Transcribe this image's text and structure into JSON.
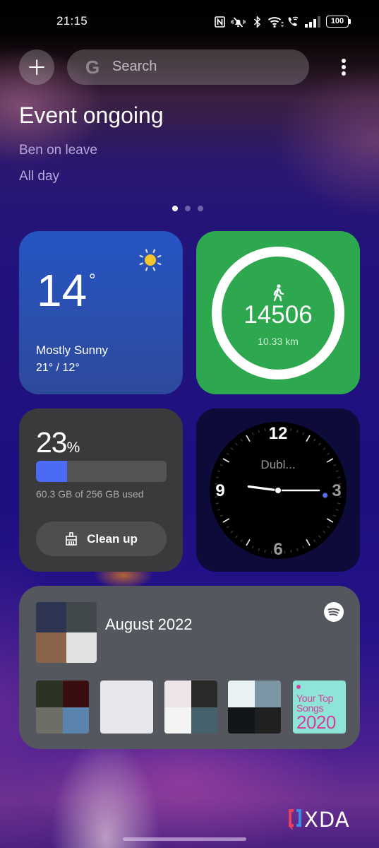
{
  "status_bar": {
    "time": "21:15",
    "battery": "100",
    "icons": [
      "nfc-icon",
      "mute-vibrate-icon",
      "bluetooth-icon",
      "wifi-icon",
      "wifi-calling-icon",
      "signal-icon",
      "battery-icon"
    ]
  },
  "header": {
    "add_icon": "plus-icon",
    "search": {
      "icon": "google-g-icon",
      "icon_glyph": "G",
      "placeholder": "Search"
    },
    "menu_icon": "kebab-menu-icon"
  },
  "event": {
    "title": "Event ongoing",
    "name": "Ben on leave",
    "when": "All day"
  },
  "pager": {
    "count": 3,
    "active": 0
  },
  "weather": {
    "icon": "sun-icon",
    "temp": "14",
    "unit": "°",
    "condition": "Mostly Sunny",
    "range": "21° / 12°",
    "colors": {
      "sun": "#f7c52a"
    }
  },
  "steps": {
    "icon": "walking-icon",
    "count": "14506",
    "distance": "10.33 km",
    "goal_progress": 1.0,
    "colors": {
      "background": "#2ea84f",
      "ring": "#ffffff"
    }
  },
  "storage": {
    "percent": "23",
    "percent_sign": "%",
    "used_fraction": 0.2355,
    "detail": "60.3 GB of 256 GB used",
    "button_label": "Clean up",
    "button_icon": "broom-icon",
    "colors": {
      "accent": "#4b6bf5"
    }
  },
  "clock": {
    "city": "Dubl...",
    "time": "21:15",
    "seconds": 16,
    "numerals": {
      "n12": "12",
      "n3": "3",
      "n6": "6",
      "n9": "9"
    },
    "colors": {
      "second_dot": "#5b6cf0"
    }
  },
  "spotify": {
    "title": "August 2022",
    "logo_icon": "spotify-icon",
    "header_art": [
      "#2d3552",
      "#41484c",
      "#8a6448",
      "#e2e2e0"
    ],
    "playlists": [
      {
        "art": [
          "#2b3324",
          "#3a0d10",
          "#6e6e66",
          "#5a84ad"
        ]
      },
      {
        "art": [
          "#e7e7ec"
        ]
      },
      {
        "art": [
          "#ece4e6",
          "#2a2a28",
          "#f4f4f4",
          "#46606c"
        ]
      },
      {
        "art": [
          "#e9f3f4",
          "#7c96a6",
          "#121619",
          "#202020"
        ]
      },
      {
        "text_art": {
          "lines": [
            "Your Top",
            "Songs"
          ],
          "year": "2020",
          "bg": "#8ee4d7",
          "fg": "#d3409a"
        }
      }
    ]
  },
  "watermark": {
    "text": "XDA",
    "colors": {
      "left": "#e8405c",
      "right": "#3b8fe8"
    }
  }
}
